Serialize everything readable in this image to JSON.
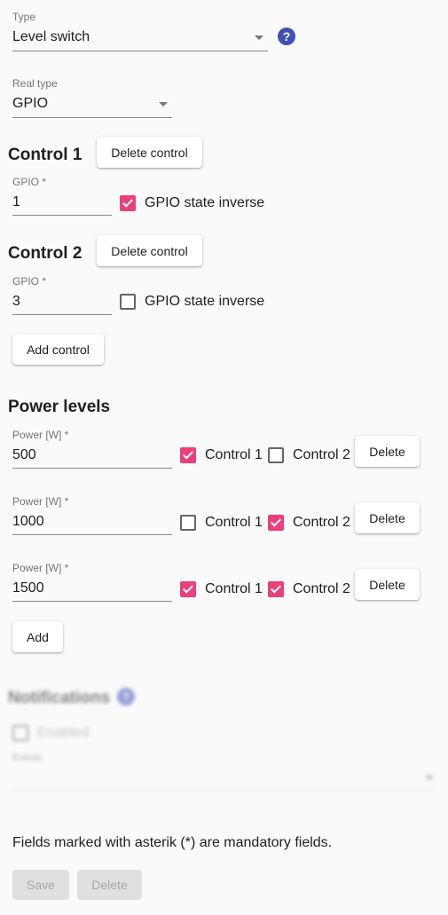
{
  "type_field": {
    "label": "Type",
    "value": "Level switch"
  },
  "real_type_field": {
    "label": "Real type",
    "value": "GPIO"
  },
  "controls": [
    {
      "title": "Control 1",
      "delete_label": "Delete control",
      "gpio_label": "GPIO *",
      "gpio_value": "1",
      "inverse_label": "GPIO state inverse",
      "inverse_checked": true
    },
    {
      "title": "Control 2",
      "delete_label": "Delete control",
      "gpio_label": "GPIO *",
      "gpio_value": "3",
      "inverse_label": "GPIO state inverse",
      "inverse_checked": false
    }
  ],
  "add_control_label": "Add control",
  "power_levels": {
    "title": "Power levels",
    "rows": [
      {
        "label": "Power [W] *",
        "value": "500",
        "control1_label": "Control 1",
        "control1_checked": true,
        "control2_label": "Control 2",
        "control2_checked": false,
        "delete_label": "Delete"
      },
      {
        "label": "Power [W] *",
        "value": "1000",
        "control1_label": "Control 1",
        "control1_checked": false,
        "control2_label": "Control 2",
        "control2_checked": true,
        "delete_label": "Delete"
      },
      {
        "label": "Power [W] *",
        "value": "1500",
        "control1_label": "Control 1",
        "control1_checked": true,
        "control2_label": "Control 2",
        "control2_checked": true,
        "delete_label": "Delete"
      }
    ],
    "add_label": "Add"
  },
  "notifications": {
    "title": "Notifications",
    "enabled_label": "Enabled",
    "events_label": "Events"
  },
  "footer": {
    "note": "Fields marked with asterik (*) are mandatory fields.",
    "save_label": "Save",
    "delete_label": "Delete"
  },
  "colors": {
    "accent": "#ec407a",
    "help": "#3f51b5"
  }
}
